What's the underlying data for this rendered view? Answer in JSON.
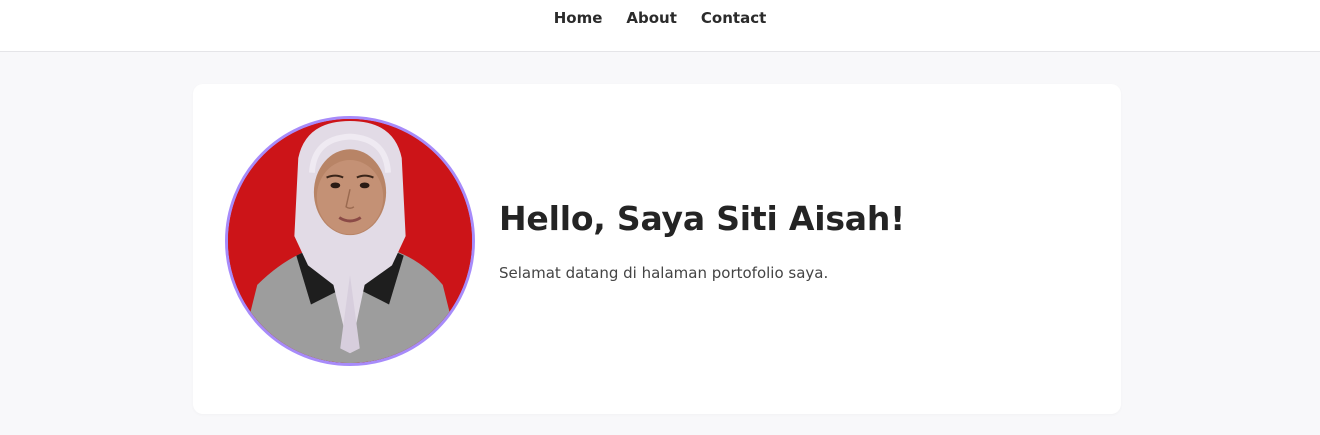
{
  "nav": {
    "items": [
      {
        "label": "Home"
      },
      {
        "label": "About"
      },
      {
        "label": "Contact"
      }
    ]
  },
  "hero": {
    "heading": "Hello, Saya Siti Aisah!",
    "subtext": "Selamat datang di halaman portofolio saya.",
    "avatar": {
      "icon": "profile-photo",
      "border_color": "#a78bfa",
      "background_color": "#d01a16"
    }
  },
  "colors": {
    "page_background": "#f8f8fa",
    "card_background": "#ffffff",
    "accent": "#a78bfa"
  }
}
